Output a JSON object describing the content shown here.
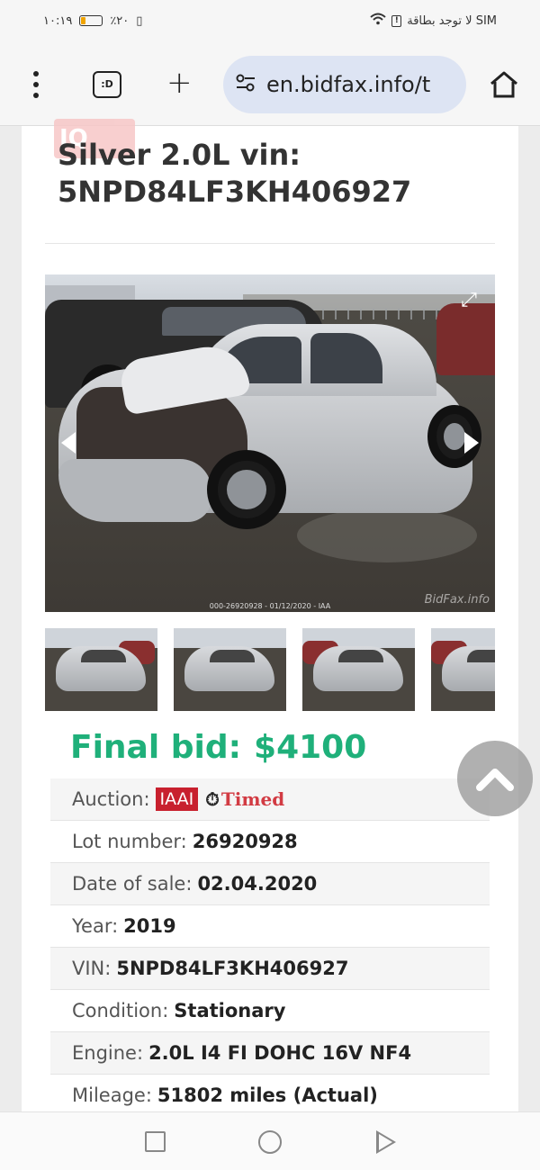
{
  "status_bar": {
    "time": "١٠:١٩",
    "battery_percent_text": "٪٢٠",
    "battery_level": 0.2,
    "carrier_text": "لا توجد بطاقة SIM"
  },
  "browser": {
    "tabs_label": ":D",
    "url": "en.bidfax.info/t"
  },
  "listing": {
    "logo_text": "IQ",
    "title_line1": "Silver 2.0L vin:",
    "title_line2": "5NPD84LF3KH406927",
    "photo_caption": "000-26920928 - 01/12/2020 - IAA",
    "photo_watermark": "BidFax.info",
    "thumbnail_count": 4,
    "active_thumbnail": 2,
    "final_bid_label": "Final bid:",
    "final_bid_value": "$4100",
    "details": {
      "auction_label": "Auction:",
      "auction_badge": "IAAI",
      "auction_type": "Timed",
      "lot_label": "Lot number:",
      "lot_value": "26920928",
      "date_label": "Date of sale:",
      "date_value": "02.04.2020",
      "year_label": "Year:",
      "year_value": "2019",
      "vin_label": "VIN:",
      "vin_value": "5NPD84LF3KH406927",
      "condition_label": "Condition:",
      "condition_value": "Stationary",
      "engine_label": "Engine:",
      "engine_value": "2.0L I4 FI DOHC 16V NF4",
      "mileage_label": "Mileage:",
      "mileage_value": "51802 miles (Actual)"
    }
  },
  "colors": {
    "final_bid": "#1fb07a",
    "iaai_badge": "#c8202e",
    "timed_text": "#d23b43",
    "active_thumb_border": "#4fb6d6"
  },
  "icons": {
    "menu": "kebab-icon",
    "tabs": "tabs-icon",
    "new_tab": "plus-icon",
    "site_settings": "tune-icon",
    "home": "home-icon",
    "scroll_top": "chevron-up-icon",
    "clock": "stopwatch-icon"
  }
}
